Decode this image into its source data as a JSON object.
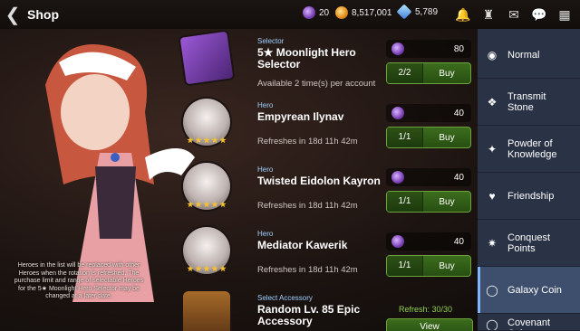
{
  "header": {
    "title": "Shop",
    "galaxy_coin": "20",
    "gold": "8,517,001",
    "crystals": "5,789"
  },
  "notice": "Heroes in the list will be replaced with other Heroes when the rotation is refreshed. The purchase limit and range of selectable Heroes for the 5★ Moonlight Hero Selector may be changed at a later date.",
  "items": [
    {
      "category": "Selector",
      "name": "5★ Moonlight Hero Selector",
      "sub": "Available 2 time(s) per account",
      "price": "80",
      "stock": "2/2",
      "buy": "Buy"
    },
    {
      "category": "Hero",
      "name": "Empyrean Ilynav",
      "sub": "Refreshes in  18d 11h 42m",
      "price": "40",
      "stock": "1/1",
      "buy": "Buy"
    },
    {
      "category": "Hero",
      "name": "Twisted Eidolon Kayron",
      "sub": "Refreshes in  18d 11h 42m",
      "price": "40",
      "stock": "1/1",
      "buy": "Buy"
    },
    {
      "category": "Hero",
      "name": "Mediator Kawerik",
      "sub": "Refreshes in  18d 11h 42m",
      "price": "40",
      "stock": "1/1",
      "buy": "Buy"
    },
    {
      "category": "Select Accessory",
      "name": "Random Lv. 85 Epic Accessory"
    }
  ],
  "refresh": "Refresh: 30/30",
  "view": "View",
  "tabs": [
    "Normal",
    "Transmit Stone",
    "Powder of Knowledge",
    "Friendship",
    "Conquest Points",
    "Galaxy Coin",
    "Covenant Coin"
  ]
}
